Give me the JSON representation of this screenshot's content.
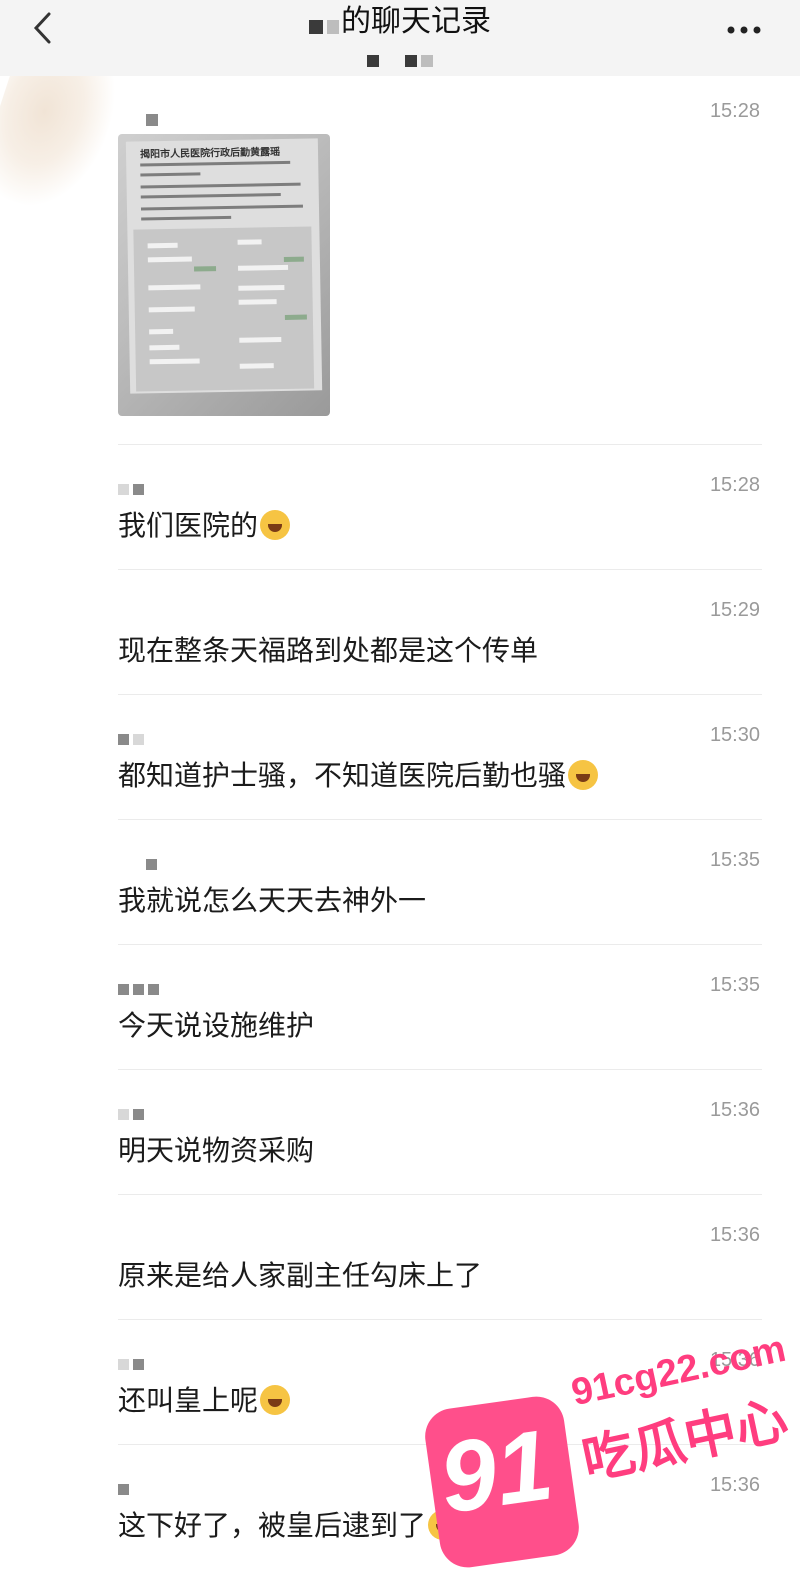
{
  "header": {
    "title": "的聊天记录",
    "back_icon": "chevron-left-icon",
    "more_icon": "more-horizontal-icon"
  },
  "image_message": {
    "time": "15:28",
    "photo_title": "揭阳市人民医院行政后勤黄露瑶"
  },
  "messages": [
    {
      "time": "15:28",
      "text": "我们医院的",
      "emoji": "crying-laughing-emoji"
    },
    {
      "time": "15:29",
      "text": "现在整条天福路到处都是这个传单"
    },
    {
      "time": "15:30",
      "text": "都知道护士骚，不知道医院后勤也骚",
      "emoji": "hand-over-mouth-emoji"
    },
    {
      "time": "15:35",
      "text": "我就说怎么天天去神外一"
    },
    {
      "time": "15:35",
      "text": "今天说设施维护"
    },
    {
      "time": "15:36",
      "text": "明天说物资采购"
    },
    {
      "time": "15:36",
      "text": "原来是给人家副主任勾床上了"
    },
    {
      "time": "15:36",
      "text": "还叫皇上呢",
      "emoji": "crying-laughing-emoji"
    },
    {
      "time": "15:36",
      "text": "这下好了，被皇后逮到了",
      "emoji": "crying-laughing-emoji"
    }
  ],
  "watermark": {
    "badge": "91",
    "url": "91cg22.com",
    "text": "吃瓜中心",
    "color": "#ff3d7f"
  }
}
